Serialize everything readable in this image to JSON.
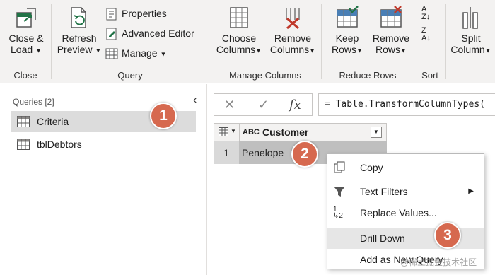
{
  "ribbon": {
    "groups": {
      "close": "Close",
      "query": "Query",
      "manage_columns": "Manage Columns",
      "reduce_rows": "Reduce Rows",
      "sort": "Sort"
    },
    "close_load": [
      "Close &",
      "Load"
    ],
    "refresh_preview": [
      "Refresh",
      "Preview"
    ],
    "properties": "Properties",
    "advanced_editor": "Advanced Editor",
    "manage": "Manage",
    "choose_columns": [
      "Choose",
      "Columns"
    ],
    "remove_columns": [
      "Remove",
      "Columns"
    ],
    "keep_rows": [
      "Keep",
      "Rows"
    ],
    "remove_rows": [
      "Remove",
      "Rows"
    ],
    "split_column": [
      "Split",
      "Column"
    ]
  },
  "queries": {
    "title": "Queries [2]",
    "items": [
      "Criteria",
      "tblDebtors"
    ]
  },
  "formula_bar": {
    "fx": "fx",
    "formula": "= Table.TransformColumnTypes("
  },
  "grid": {
    "column_type": "ABC",
    "column": "Customer",
    "rows": [
      {
        "num": "1",
        "value": "Penelope"
      }
    ]
  },
  "context_menu": {
    "items": [
      "Copy",
      "Text Filters",
      "Replace Values...",
      "Drill Down",
      "Add as New Query"
    ]
  },
  "callouts": [
    "1",
    "2",
    "3"
  ],
  "watermark": "@稀土掘金技术社区",
  "colors": {
    "callout": "#d6694f",
    "accent_green": "#217346",
    "remove_red": "#c0392b"
  }
}
